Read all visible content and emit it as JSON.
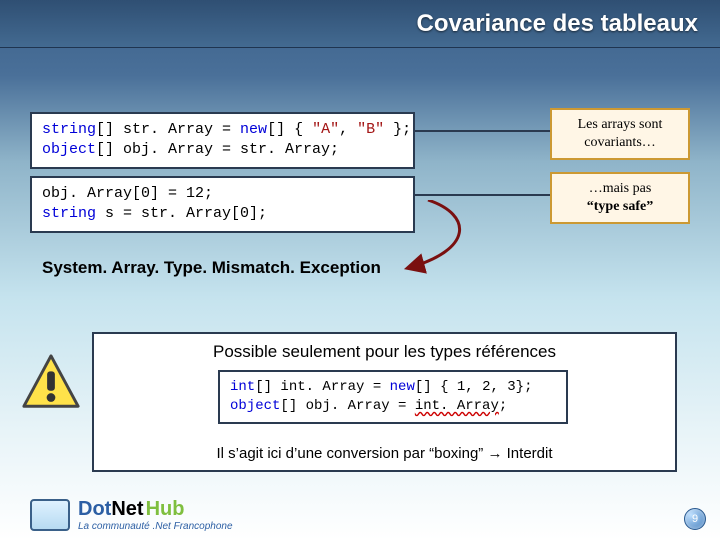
{
  "title": "Covariance des tableaux",
  "code1": {
    "line1_pre": "string",
    "line1_mid": "[] str. Array = ",
    "line1_new": "new",
    "line1_post": "[] { ",
    "line1_strA": "\"A\"",
    "line1_sep": ", ",
    "line1_strB": "\"B\"",
    "line1_end": " };",
    "line2_pre": "object",
    "line2_post": "[] obj. Array = str. Array;"
  },
  "code2": {
    "line1": "obj. Array[0] = 12;",
    "line2_pre": "string",
    "line2_post": " s = str. Array[0];"
  },
  "callout1": {
    "l1": "Les arrays sont",
    "l2": "covariants…"
  },
  "callout2": {
    "l1": "…mais pas",
    "l2": "“type safe”"
  },
  "exception": "System. Array. Type. Mismatch. Exception",
  "panel": {
    "heading": "Possible seulement pour les types références",
    "footline_pre": "Il s’agit ici d’une conversion par “boxing” ",
    "footline_arrow": "→",
    "footline_post": " Interdit"
  },
  "code3": {
    "line1_kw1": "int",
    "line1_a": "[] int. Array = ",
    "line1_kw2": "new",
    "line1_b": "[] { 1, 2, 3};",
    "line2_kw": "object",
    "line2_a": "[] obj. Array = ",
    "line2_wavy": "int. Array",
    "line2_end": ";"
  },
  "footer": {
    "brand_dot": "Dot",
    "brand_net": "Net",
    "brand_hub": "Hub",
    "tagline": "La communauté .Net Francophone"
  },
  "page": "9"
}
